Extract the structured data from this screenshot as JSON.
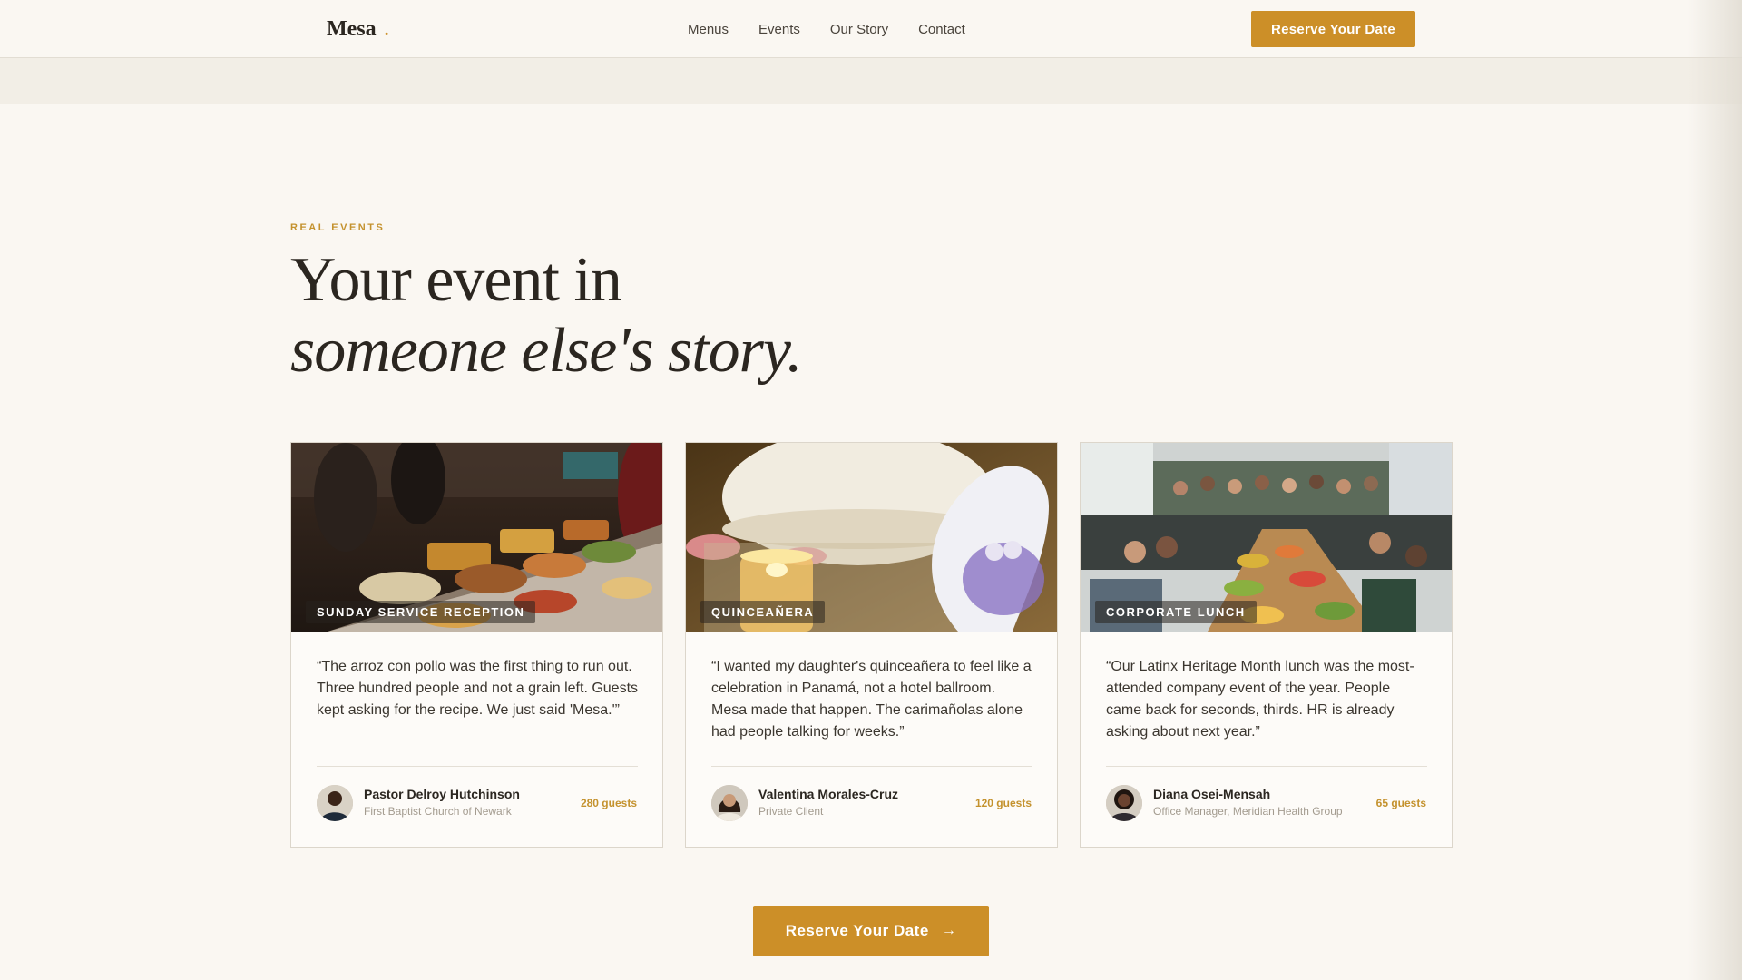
{
  "header": {
    "logo": "Mesa",
    "logo_dot": ".",
    "nav": [
      "Menus",
      "Events",
      "Our Story",
      "Contact"
    ],
    "cta": "Reserve Your Date"
  },
  "section": {
    "eyebrow": "REAL EVENTS",
    "headline_line1": "Your event in",
    "headline_line2": "someone else's story."
  },
  "cards": [
    {
      "tag": "SUNDAY SERVICE RECEPTION",
      "quote": "“The arroz con pollo was the first thing to run out. Three hundred people and not a grain left. Guests kept asking for the recipe. We just said 'Mesa.'”",
      "name": "Pastor Delroy Hutchinson",
      "role": "First Baptist Church of Newark",
      "guests": "280 guests"
    },
    {
      "tag": "QUINCEAÑERA",
      "quote": "“I wanted my daughter's quinceañera to feel like a celebration in Panamá, not a hotel ballroom. Mesa made that happen. The carimañolas alone had people talking for weeks.”",
      "name": "Valentina Morales-Cruz",
      "role": "Private Client",
      "guests": "120 guests"
    },
    {
      "tag": "CORPORATE LUNCH",
      "quote": "“Our Latinx Heritage Month lunch was the most-attended company event of the year. People came back for seconds, thirds. HR is already asking about next year.”",
      "name": "Diana Osei-Mensah",
      "role": "Office Manager, Meridian Health Group",
      "guests": "65 guests"
    }
  ],
  "footer_cta": {
    "label": "Reserve Your Date",
    "icon": "arrow-right-icon"
  },
  "colors": {
    "accent": "#cc8f28",
    "background": "#faf7f2",
    "text": "#2b2620"
  }
}
